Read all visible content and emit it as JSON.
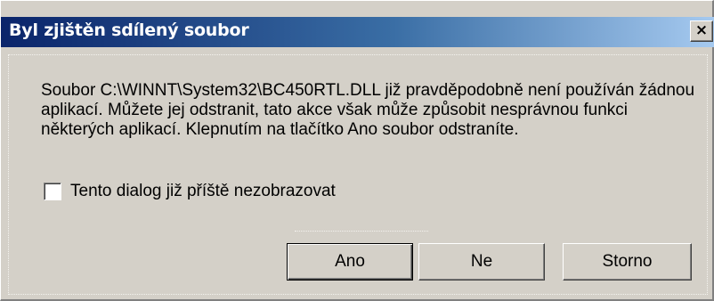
{
  "window": {
    "title": "Byl zjištěn sdílený soubor",
    "close_glyph": "×"
  },
  "message": {
    "text": "Soubor C:\\WINNT\\System32\\BC450RTL.DLL již pravděpodobně není používán žádnou aplikací. Můžete jej odstranit, tato akce však může způsobit nesprávnou funkci některých aplikací. Klepnutím na tlačítko Ano soubor odstraníte."
  },
  "checkbox": {
    "label": "Tento dialog již příště nezobrazovat",
    "checked": false
  },
  "buttons": {
    "yes": "Ano",
    "no": "Ne",
    "cancel": "Storno"
  }
}
